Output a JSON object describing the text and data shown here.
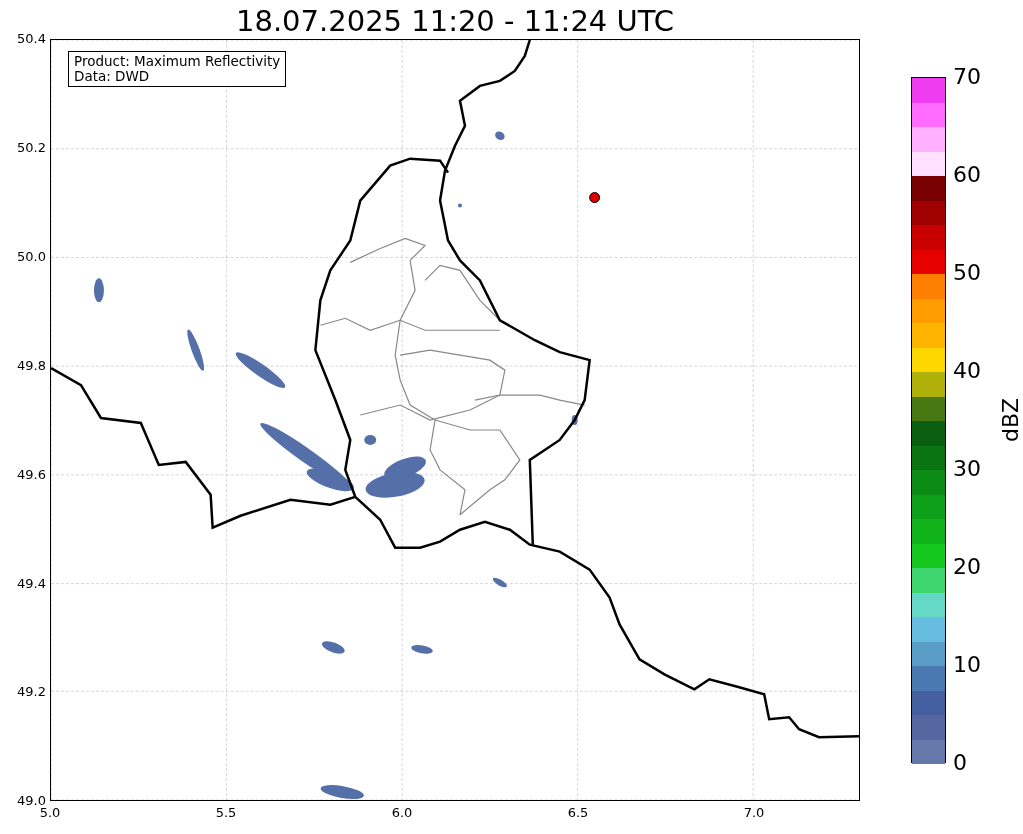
{
  "title": "18.07.2025 11:20 - 11:24 UTC",
  "legend": {
    "lines": [
      "Product: Maximum Reflectivity",
      "Data: DWD"
    ]
  },
  "map": {
    "x_ticks": [
      "5.0",
      "5.5",
      "6.0",
      "6.5",
      "7.0"
    ],
    "y_ticks": [
      "50.4",
      "50.2",
      "50.0",
      "49.8",
      "49.6",
      "49.4",
      "49.2",
      "49.0"
    ]
  },
  "colorbar": {
    "label": "dBZ",
    "ticks": [
      "70",
      "60",
      "50",
      "40",
      "30",
      "20",
      "10",
      "0"
    ],
    "bands": [
      {
        "color": "#f03cf0"
      },
      {
        "color": "#ff6cff"
      },
      {
        "color": "#ffb0ff"
      },
      {
        "color": "#ffe0ff"
      },
      {
        "color": "#780000"
      },
      {
        "color": "#a00000"
      },
      {
        "color": "#c80000"
      },
      {
        "color": "#e60000"
      },
      {
        "color": "#ff8000"
      },
      {
        "color": "#ff9c00"
      },
      {
        "color": "#ffb400"
      },
      {
        "color": "#ffd700"
      },
      {
        "color": "#b0b00a"
      },
      {
        "color": "#477812"
      },
      {
        "color": "#0a5e10"
      },
      {
        "color": "#0a7412"
      },
      {
        "color": "#0b8a14"
      },
      {
        "color": "#0ea018"
      },
      {
        "color": "#10b41a"
      },
      {
        "color": "#14c81e"
      },
      {
        "color": "#3ed46e"
      },
      {
        "color": "#66d8c8"
      },
      {
        "color": "#66bde0"
      },
      {
        "color": "#5a9ec8"
      },
      {
        "color": "#4a78b0"
      },
      {
        "color": "#4560a0"
      },
      {
        "color": "#5566a0"
      },
      {
        "color": "#6677aa"
      }
    ]
  }
}
